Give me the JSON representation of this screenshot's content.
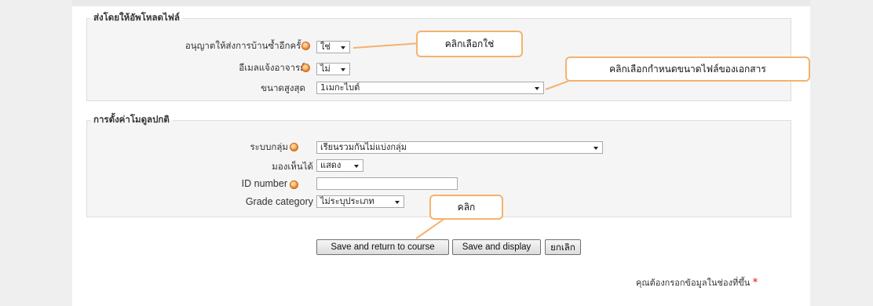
{
  "upload_section": {
    "legend": "ส่งโดยให้อัพโหลดไฟล์",
    "resubmit_label": "อนุญาตให้ส่งการบ้านซ้ำอีกครั้ง",
    "resubmit_value": "ใช่",
    "email_label": "อีเมลแจ้งอาจารย์",
    "email_value": "ไม่",
    "maxsize_label": "ขนาดสูงสุด",
    "maxsize_value": "1เมกะไบต์"
  },
  "module_section": {
    "legend": "การตั้งค่าโมดูลปกติ",
    "group_label": "ระบบกลุ่ม",
    "group_value": "เรียนรวมกันไม่แบ่งกลุ่ม",
    "visible_label": "มองเห็นได้",
    "visible_value": "แสดง",
    "idnumber_label": "ID number",
    "idnumber_value": "",
    "grade_label": "Grade category",
    "grade_value": "ไม่ระบุประเภท"
  },
  "buttons": {
    "save_return": "Save and return to course",
    "save_display": "Save and display",
    "cancel": "ยกเลิก"
  },
  "required_note": "คุณต้องกรอกข้อมูลในช่องที่ขึ้น",
  "required_star": "*",
  "annotations": {
    "select_yes": "คลิกเลือกใช่",
    "select_size": "คลิกเลือกกำหนดขนาดไฟล์ของเอกสาร",
    "click": "คลิก"
  },
  "colors": {
    "callout_border": "#f3b36d",
    "help_icon": "#f08a2c",
    "required_star": "#ee0000"
  }
}
